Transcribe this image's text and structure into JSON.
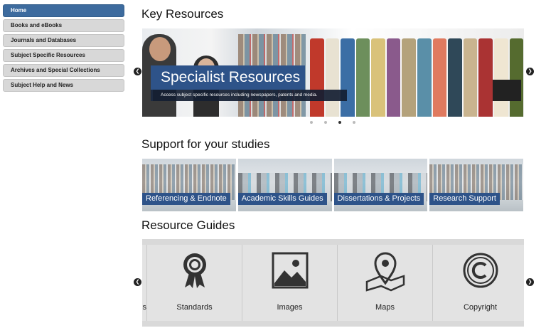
{
  "sidebar": {
    "items": [
      {
        "label": "Home",
        "active": true
      },
      {
        "label": "Books and eBooks"
      },
      {
        "label": "Journals and Databases"
      },
      {
        "label": "Subject Specific Resources"
      },
      {
        "label": "Archives and Special Collections"
      },
      {
        "label": "Subject Help and News"
      }
    ]
  },
  "key_resources": {
    "title": "Key Resources",
    "slide": {
      "heading": "Specialist Resources",
      "caption": "Access subject specific resources including newspapers, patents and media."
    },
    "dots_total": 4,
    "active_dot": 3,
    "prev_icon": "chevron-left-icon",
    "next_icon": "chevron-right-icon"
  },
  "support": {
    "title": "Support for your studies",
    "tiles": [
      {
        "label": "Referencing & Endnote"
      },
      {
        "label": "Academic Skills Guides"
      },
      {
        "label": "Dissertations & Projects"
      },
      {
        "label": "Research Support"
      }
    ]
  },
  "guides": {
    "title": "Resource Guides",
    "peek_label": "s",
    "items": [
      {
        "label": "Standards",
        "icon": "award-ribbon-icon"
      },
      {
        "label": "Images",
        "icon": "image-icon"
      },
      {
        "label": "Maps",
        "icon": "map-pin-icon"
      },
      {
        "label": "Copyright",
        "icon": "copyright-icon"
      }
    ]
  },
  "colors": {
    "accent": "#2e5389",
    "sidebar_active": "#3d6b9e",
    "sidebar_item": "#d8d8d8"
  }
}
